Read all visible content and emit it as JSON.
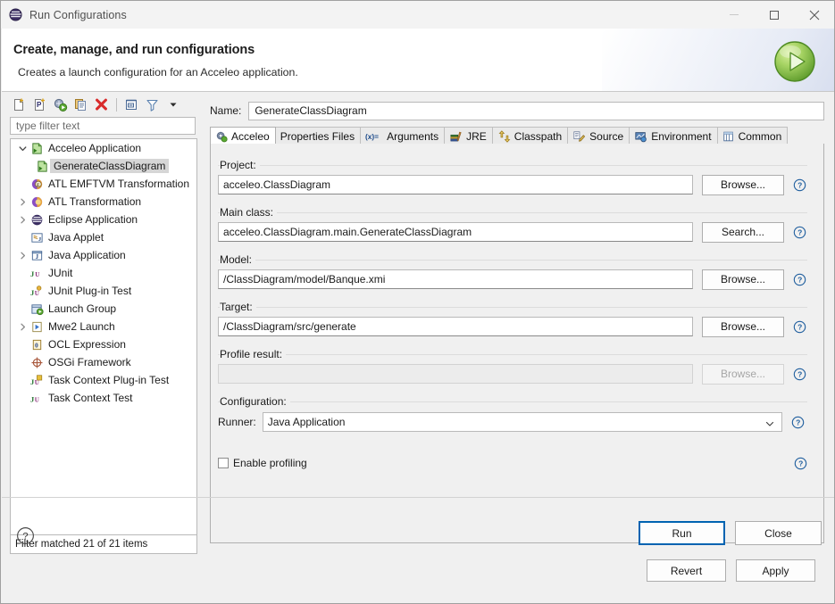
{
  "window": {
    "title": "Run Configurations",
    "app_icon": "eclipse-icon",
    "minimize_label": "",
    "maximize_label": "",
    "close_label": ""
  },
  "header": {
    "title": "Create, manage, and run configurations",
    "subtitle": "Creates a launch configuration for an Acceleo application.",
    "banner_icon": "run-green-play-icon"
  },
  "left_panel": {
    "toolbar": [
      {
        "name": "new-configuration-icon",
        "tooltip": "New launch configuration"
      },
      {
        "name": "new-prototype-icon",
        "tooltip": "New prototype"
      },
      {
        "name": "export-configuration-icon",
        "tooltip": "Export"
      },
      {
        "name": "duplicate-configuration-icon",
        "tooltip": "Duplicate"
      },
      {
        "name": "delete-configuration-icon",
        "tooltip": "Delete"
      },
      {
        "name": "collapse-all-icon",
        "tooltip": "Collapse All"
      },
      {
        "name": "filter-icon",
        "tooltip": "Filter launch configurations"
      },
      {
        "name": "view-menu-icon",
        "tooltip": "View Menu"
      }
    ],
    "filter": {
      "placeholder": "type filter text",
      "value": ""
    },
    "tree": [
      {
        "label": "Acceleo Application",
        "icon": "acceleo-icon",
        "indent": 0,
        "twisty": "expanded",
        "selected": false
      },
      {
        "label": "GenerateClassDiagram",
        "icon": "acceleo-icon",
        "indent": 1,
        "twisty": "none",
        "selected": true
      },
      {
        "label": "ATL EMFTVM Transformation",
        "icon": "atl-emftvm-icon",
        "indent": 0,
        "twisty": "none",
        "selected": false
      },
      {
        "label": "ATL Transformation",
        "icon": "atl-icon",
        "indent": 0,
        "twisty": "collapsed",
        "selected": false
      },
      {
        "label": "Eclipse Application",
        "icon": "eclipse-icon",
        "indent": 0,
        "twisty": "collapsed",
        "selected": false
      },
      {
        "label": "Java Applet",
        "icon": "java-applet-icon",
        "indent": 0,
        "twisty": "none",
        "selected": false
      },
      {
        "label": "Java Application",
        "icon": "java-application-icon",
        "indent": 0,
        "twisty": "collapsed",
        "selected": false
      },
      {
        "label": "JUnit",
        "icon": "junit-icon",
        "indent": 0,
        "twisty": "none",
        "selected": false
      },
      {
        "label": "JUnit Plug-in Test",
        "icon": "junit-plugin-icon",
        "indent": 0,
        "twisty": "none",
        "selected": false
      },
      {
        "label": "Launch Group",
        "icon": "launch-group-icon",
        "indent": 0,
        "twisty": "none",
        "selected": false
      },
      {
        "label": "Mwe2 Launch",
        "icon": "mwe2-icon",
        "indent": 0,
        "twisty": "collapsed",
        "selected": false
      },
      {
        "label": "OCL Expression",
        "icon": "ocl-icon",
        "indent": 0,
        "twisty": "none",
        "selected": false
      },
      {
        "label": "OSGi Framework",
        "icon": "osgi-icon",
        "indent": 0,
        "twisty": "none",
        "selected": false
      },
      {
        "label": "Task Context Plug-in Test",
        "icon": "task-context-plugin-icon",
        "indent": 0,
        "twisty": "none",
        "selected": false
      },
      {
        "label": "Task Context Test",
        "icon": "task-context-icon",
        "indent": 0,
        "twisty": "none",
        "selected": false
      }
    ],
    "status": "Filter matched 21 of 21 items"
  },
  "right_panel": {
    "name_label": "Name:",
    "name_value": "GenerateClassDiagram",
    "tabs": [
      {
        "label": "Acceleo",
        "icon": "acceleo-gear-icon",
        "active": true
      },
      {
        "label": "Properties Files",
        "icon": "",
        "active": false
      },
      {
        "label": "Arguments",
        "icon": "arguments-icon",
        "active": false
      },
      {
        "label": "JRE",
        "icon": "jre-icon",
        "active": false
      },
      {
        "label": "Classpath",
        "icon": "classpath-icon",
        "active": false
      },
      {
        "label": "Source",
        "icon": "source-icon",
        "active": false
      },
      {
        "label": "Environment",
        "icon": "environment-icon",
        "active": false
      },
      {
        "label": "Common",
        "icon": "common-icon",
        "active": false
      }
    ],
    "fields": [
      {
        "group": "Project:",
        "value": "acceleo.ClassDiagram",
        "button": "Browse...",
        "disabled": false,
        "help": "?"
      },
      {
        "group": "Main class:",
        "value": "acceleo.ClassDiagram.main.GenerateClassDiagram",
        "button": "Search...",
        "disabled": false,
        "help": "?"
      },
      {
        "group": "Model:",
        "value": "/ClassDiagram/model/Banque.xmi",
        "button": "Browse...",
        "disabled": false,
        "help": "?"
      },
      {
        "group": "Target:",
        "value": "/ClassDiagram/src/generate",
        "button": "Browse...",
        "disabled": false,
        "help": "?"
      },
      {
        "group": "Profile result:",
        "value": "",
        "button": "Browse...",
        "disabled": true,
        "help": "?"
      }
    ],
    "configuration": {
      "group": "Configuration:",
      "runner_label": "Runner:",
      "runner_value": "Java Application",
      "runner_options": [
        "Java Application"
      ],
      "help": "?"
    },
    "enable_profiling": {
      "label": "Enable profiling",
      "checked": false,
      "help": "?"
    },
    "revert_label": "Revert",
    "apply_label": "Apply"
  },
  "footer": {
    "help_icon": "help-icon",
    "run_label": "Run",
    "close_label": "Close"
  },
  "colors": {
    "accent": "#0063b1",
    "help_blue": "#1f5e9e",
    "selection": "#d6d6d6",
    "dialog_bg": "#f0f0f0",
    "field_bg": "#ffffff",
    "run_green": "#6db33f"
  }
}
